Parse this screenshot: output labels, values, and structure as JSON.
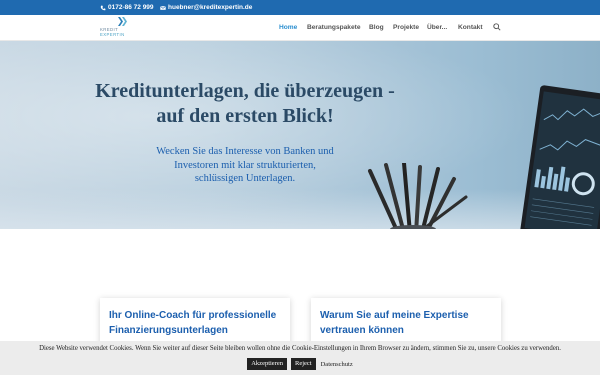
{
  "topbar": {
    "phone": "0172-86 72 999",
    "email": "huebner@kreditexpertin.de",
    "background": "#1f6ab0"
  },
  "logo": {
    "line1": "KREDIT",
    "line2": "EXPERTIN"
  },
  "nav": {
    "items": [
      {
        "label": "Home",
        "active": true
      },
      {
        "label": "Beratungspakete",
        "active": false
      },
      {
        "label": "Blog",
        "active": false
      },
      {
        "label": "Projekte",
        "active": false
      },
      {
        "label": "Über...",
        "active": false
      },
      {
        "label": "Kontakt",
        "active": false
      }
    ],
    "active_color": "#2c8fd0",
    "search_icon": "search-icon"
  },
  "hero": {
    "heading_line1": "Kreditunterlagen, die überzeugen -",
    "heading_line2": "auf den ersten Blick!",
    "sub_line1": "Wecken Sie das Interesse von Banken und",
    "sub_line2": "Investoren mit klar strukturierten,",
    "sub_line3": "schlüssigen Unterlagen.",
    "heading_color": "#2b4a66",
    "sub_color": "#1c5fae"
  },
  "cards": [
    {
      "title_line1": "Ihr Online-Coach für professionelle",
      "title_line2": "Finanzierungsunterlagen"
    },
    {
      "title_line1": "Warum Sie auf meine Expertise",
      "title_line2": "vertrauen können"
    }
  ],
  "cookie": {
    "message": "Diese Website verwendet Cookies. Wenn Sie weiter auf dieser Seite bleiben wollen ohne die Cookie-Einstellungen in Ihrem Browser zu ändern, stimmen Sie zu, unsere Cookies zu verwenden.",
    "accept_label": "Akzeptieren",
    "reject_label": "Reject",
    "privacy_label": "Datenschutz"
  }
}
